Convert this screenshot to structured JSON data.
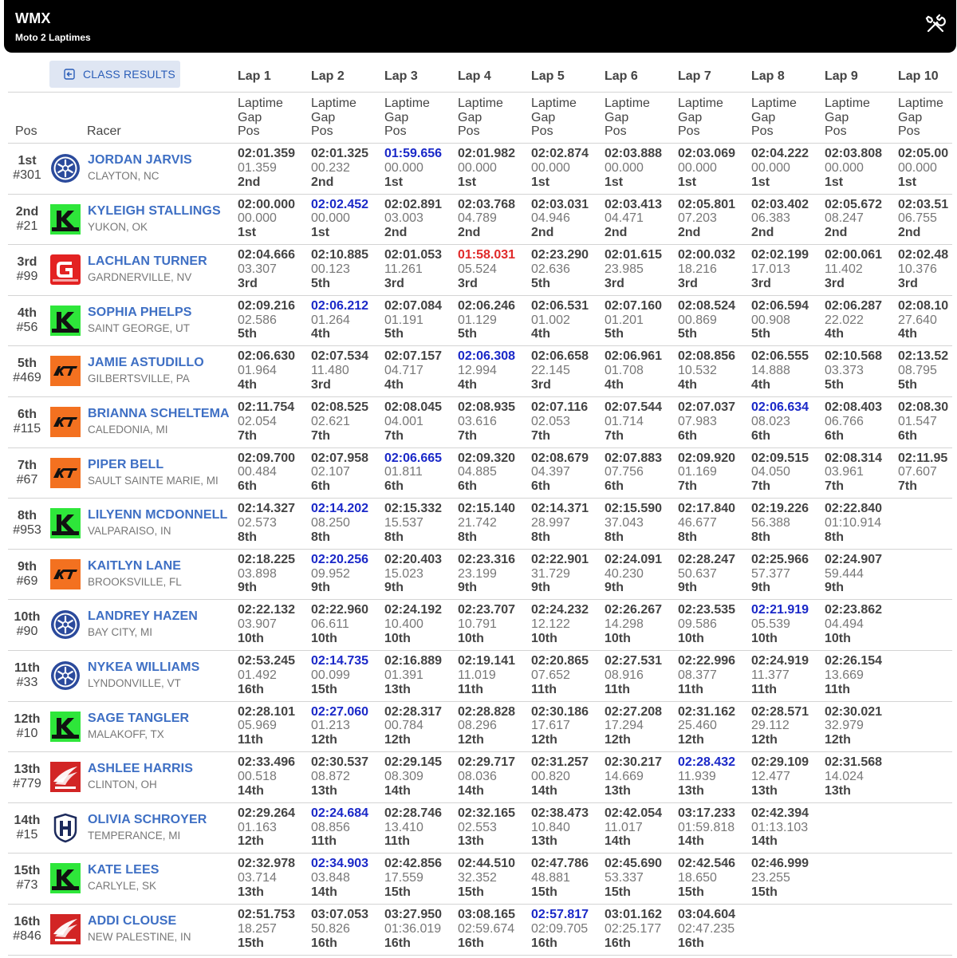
{
  "app": {
    "title": "WMX",
    "subtitle": "Moto 2 Laptimes"
  },
  "class_button": {
    "label": "CLASS RESULTS"
  },
  "headers": {
    "pos": "Pos",
    "racer": "Racer",
    "laps": [
      "Lap 1",
      "Lap 2",
      "Lap 3",
      "Lap 4",
      "Lap 5",
      "Lap 6",
      "Lap 7",
      "Lap 8",
      "Lap 9",
      "Lap 10"
    ],
    "sub": [
      "Laptime",
      "Gap",
      "Pos"
    ]
  },
  "colors": {
    "accent": "#3e6fc4",
    "best_lap": "#1a28c8",
    "worst_lap": "#e02a2a",
    "topbar": "#000000",
    "button_bg": "#dfe6f3"
  },
  "rows": [
    {
      "pos": "1st",
      "num": "#301",
      "name": "JORDAN JARVIS",
      "loc": "CLAYTON, NC",
      "logo": "yamaha-logo",
      "laps": [
        {
          "t": "02:01.359",
          "g": "01.359",
          "p": "2nd"
        },
        {
          "t": "02:01.325",
          "g": "00.232",
          "p": "2nd"
        },
        {
          "t": "01:59.656",
          "g": "00.000",
          "p": "1st",
          "s": "best"
        },
        {
          "t": "02:01.982",
          "g": "00.000",
          "p": "1st"
        },
        {
          "t": "02:02.874",
          "g": "00.000",
          "p": "1st"
        },
        {
          "t": "02:03.888",
          "g": "00.000",
          "p": "1st"
        },
        {
          "t": "02:03.069",
          "g": "00.000",
          "p": "1st"
        },
        {
          "t": "02:04.222",
          "g": "00.000",
          "p": "1st"
        },
        {
          "t": "02:03.808",
          "g": "00.000",
          "p": "1st"
        },
        {
          "t": "02:05.00",
          "g": "00.000",
          "p": "1st"
        }
      ]
    },
    {
      "pos": "2nd",
      "num": "#21",
      "name": "KYLEIGH STALLINGS",
      "loc": "YUKON, OK",
      "logo": "kawasaki-logo",
      "laps": [
        {
          "t": "02:00.000",
          "g": "00.000",
          "p": "1st"
        },
        {
          "t": "02:02.452",
          "g": "00.000",
          "p": "1st",
          "s": "best"
        },
        {
          "t": "02:02.891",
          "g": "03.003",
          "p": "2nd"
        },
        {
          "t": "02:03.768",
          "g": "04.789",
          "p": "2nd"
        },
        {
          "t": "02:03.031",
          "g": "04.946",
          "p": "2nd"
        },
        {
          "t": "02:03.413",
          "g": "04.471",
          "p": "2nd"
        },
        {
          "t": "02:05.801",
          "g": "07.203",
          "p": "2nd"
        },
        {
          "t": "02:03.402",
          "g": "06.383",
          "p": "2nd"
        },
        {
          "t": "02:05.672",
          "g": "08.247",
          "p": "2nd"
        },
        {
          "t": "02:03.51",
          "g": "06.755",
          "p": "2nd"
        }
      ]
    },
    {
      "pos": "3rd",
      "num": "#99",
      "name": "LACHLAN TURNER",
      "loc": "GARDNERVILLE, NV",
      "logo": "gasgas-logo",
      "laps": [
        {
          "t": "02:04.666",
          "g": "03.307",
          "p": "3rd"
        },
        {
          "t": "02:10.885",
          "g": "00.123",
          "p": "5th"
        },
        {
          "t": "02:01.053",
          "g": "11.261",
          "p": "3rd"
        },
        {
          "t": "01:58.031",
          "g": "05.524",
          "p": "3rd",
          "s": "worst"
        },
        {
          "t": "02:23.290",
          "g": "02.636",
          "p": "5th"
        },
        {
          "t": "02:01.615",
          "g": "23.985",
          "p": "3rd"
        },
        {
          "t": "02:00.032",
          "g": "18.216",
          "p": "3rd"
        },
        {
          "t": "02:02.199",
          "g": "17.013",
          "p": "3rd"
        },
        {
          "t": "02:00.061",
          "g": "11.402",
          "p": "3rd"
        },
        {
          "t": "02:02.48",
          "g": "10.376",
          "p": "3rd"
        }
      ]
    },
    {
      "pos": "4th",
      "num": "#56",
      "name": "SOPHIA PHELPS",
      "loc": "SAINT GEORGE, UT",
      "logo": "kawasaki-logo",
      "laps": [
        {
          "t": "02:09.216",
          "g": "02.586",
          "p": "5th"
        },
        {
          "t": "02:06.212",
          "g": "01.264",
          "p": "4th",
          "s": "best"
        },
        {
          "t": "02:07.084",
          "g": "01.191",
          "p": "5th"
        },
        {
          "t": "02:06.246",
          "g": "01.129",
          "p": "5th"
        },
        {
          "t": "02:06.531",
          "g": "01.002",
          "p": "4th"
        },
        {
          "t": "02:07.160",
          "g": "01.201",
          "p": "5th"
        },
        {
          "t": "02:08.524",
          "g": "00.869",
          "p": "5th"
        },
        {
          "t": "02:06.594",
          "g": "00.908",
          "p": "5th"
        },
        {
          "t": "02:06.287",
          "g": "22.022",
          "p": "4th"
        },
        {
          "t": "02:08.10",
          "g": "27.640",
          "p": "4th"
        }
      ]
    },
    {
      "pos": "5th",
      "num": "#469",
      "name": "JAMIE ASTUDILLO",
      "loc": "GILBERTSVILLE, PA",
      "logo": "ktm-logo",
      "laps": [
        {
          "t": "02:06.630",
          "g": "01.964",
          "p": "4th"
        },
        {
          "t": "02:07.534",
          "g": "11.480",
          "p": "3rd"
        },
        {
          "t": "02:07.157",
          "g": "04.717",
          "p": "4th"
        },
        {
          "t": "02:06.308",
          "g": "12.994",
          "p": "4th",
          "s": "best"
        },
        {
          "t": "02:06.658",
          "g": "22.145",
          "p": "3rd"
        },
        {
          "t": "02:06.961",
          "g": "01.708",
          "p": "4th"
        },
        {
          "t": "02:08.856",
          "g": "10.532",
          "p": "4th"
        },
        {
          "t": "02:06.555",
          "g": "14.888",
          "p": "4th"
        },
        {
          "t": "02:10.568",
          "g": "03.373",
          "p": "5th"
        },
        {
          "t": "02:13.52",
          "g": "08.795",
          "p": "5th"
        }
      ]
    },
    {
      "pos": "6th",
      "num": "#115",
      "name": "BRIANNA SCHELTEMA",
      "loc": "CALEDONIA, MI",
      "logo": "ktm-logo",
      "laps": [
        {
          "t": "02:11.754",
          "g": "02.054",
          "p": "7th"
        },
        {
          "t": "02:08.525",
          "g": "02.621",
          "p": "7th"
        },
        {
          "t": "02:08.045",
          "g": "04.001",
          "p": "7th"
        },
        {
          "t": "02:08.935",
          "g": "03.616",
          "p": "7th"
        },
        {
          "t": "02:07.116",
          "g": "02.053",
          "p": "7th"
        },
        {
          "t": "02:07.544",
          "g": "01.714",
          "p": "7th"
        },
        {
          "t": "02:07.037",
          "g": "07.983",
          "p": "6th"
        },
        {
          "t": "02:06.634",
          "g": "08.023",
          "p": "6th",
          "s": "best"
        },
        {
          "t": "02:08.403",
          "g": "06.766",
          "p": "6th"
        },
        {
          "t": "02:08.30",
          "g": "01.547",
          "p": "6th"
        }
      ]
    },
    {
      "pos": "7th",
      "num": "#67",
      "name": "PIPER BELL",
      "loc": "SAULT SAINTE MARIE, MI",
      "logo": "ktm-logo",
      "laps": [
        {
          "t": "02:09.700",
          "g": "00.484",
          "p": "6th"
        },
        {
          "t": "02:07.958",
          "g": "02.107",
          "p": "6th"
        },
        {
          "t": "02:06.665",
          "g": "01.811",
          "p": "6th",
          "s": "best"
        },
        {
          "t": "02:09.320",
          "g": "04.885",
          "p": "6th"
        },
        {
          "t": "02:08.679",
          "g": "04.397",
          "p": "6th"
        },
        {
          "t": "02:07.883",
          "g": "07.756",
          "p": "6th"
        },
        {
          "t": "02:09.920",
          "g": "01.169",
          "p": "7th"
        },
        {
          "t": "02:09.515",
          "g": "04.050",
          "p": "7th"
        },
        {
          "t": "02:08.314",
          "g": "03.961",
          "p": "7th"
        },
        {
          "t": "02:11.95",
          "g": "07.607",
          "p": "7th"
        }
      ]
    },
    {
      "pos": "8th",
      "num": "#953",
      "name": "LILYENN MCDONNELL",
      "loc": "VALPARAISO, IN",
      "logo": "kawasaki-logo",
      "laps": [
        {
          "t": "02:14.327",
          "g": "02.573",
          "p": "8th"
        },
        {
          "t": "02:14.202",
          "g": "08.250",
          "p": "8th",
          "s": "best"
        },
        {
          "t": "02:15.332",
          "g": "15.537",
          "p": "8th"
        },
        {
          "t": "02:15.140",
          "g": "21.742",
          "p": "8th"
        },
        {
          "t": "02:14.371",
          "g": "28.997",
          "p": "8th"
        },
        {
          "t": "02:15.590",
          "g": "37.043",
          "p": "8th"
        },
        {
          "t": "02:17.840",
          "g": "46.677",
          "p": "8th"
        },
        {
          "t": "02:19.226",
          "g": "56.388",
          "p": "8th"
        },
        {
          "t": "02:22.840",
          "g": "01:10.914",
          "p": "8th"
        }
      ]
    },
    {
      "pos": "9th",
      "num": "#69",
      "name": "KAITLYN LANE",
      "loc": "BROOKSVILLE, FL",
      "logo": "ktm-logo",
      "laps": [
        {
          "t": "02:18.225",
          "g": "03.898",
          "p": "9th"
        },
        {
          "t": "02:20.256",
          "g": "09.952",
          "p": "9th",
          "s": "best"
        },
        {
          "t": "02:20.403",
          "g": "15.023",
          "p": "9th"
        },
        {
          "t": "02:23.316",
          "g": "23.199",
          "p": "9th"
        },
        {
          "t": "02:22.901",
          "g": "31.729",
          "p": "9th"
        },
        {
          "t": "02:24.091",
          "g": "40.230",
          "p": "9th"
        },
        {
          "t": "02:28.247",
          "g": "50.637",
          "p": "9th"
        },
        {
          "t": "02:25.966",
          "g": "57.377",
          "p": "9th"
        },
        {
          "t": "02:24.907",
          "g": "59.444",
          "p": "9th"
        }
      ]
    },
    {
      "pos": "10th",
      "num": "#90",
      "name": "LANDREY HAZEN",
      "loc": "BAY CITY, MI",
      "logo": "yamaha-logo",
      "laps": [
        {
          "t": "02:22.132",
          "g": "03.907",
          "p": "10th"
        },
        {
          "t": "02:22.960",
          "g": "06.611",
          "p": "10th"
        },
        {
          "t": "02:24.192",
          "g": "10.400",
          "p": "10th"
        },
        {
          "t": "02:23.707",
          "g": "10.791",
          "p": "10th"
        },
        {
          "t": "02:24.232",
          "g": "12.122",
          "p": "10th"
        },
        {
          "t": "02:26.267",
          "g": "14.298",
          "p": "10th"
        },
        {
          "t": "02:23.535",
          "g": "09.586",
          "p": "10th"
        },
        {
          "t": "02:21.919",
          "g": "05.539",
          "p": "10th",
          "s": "best"
        },
        {
          "t": "02:23.862",
          "g": "04.494",
          "p": "10th"
        }
      ]
    },
    {
      "pos": "11th",
      "num": "#33",
      "name": "NYKEA WILLIAMS",
      "loc": "LYNDONVILLE, VT",
      "logo": "yamaha-logo",
      "laps": [
        {
          "t": "02:53.245",
          "g": "01.492",
          "p": "16th"
        },
        {
          "t": "02:14.735",
          "g": "00.099",
          "p": "15th",
          "s": "best"
        },
        {
          "t": "02:16.889",
          "g": "01.391",
          "p": "13th"
        },
        {
          "t": "02:19.141",
          "g": "11.019",
          "p": "11th"
        },
        {
          "t": "02:20.865",
          "g": "07.652",
          "p": "11th"
        },
        {
          "t": "02:27.531",
          "g": "08.916",
          "p": "11th"
        },
        {
          "t": "02:22.996",
          "g": "08.377",
          "p": "11th"
        },
        {
          "t": "02:24.919",
          "g": "11.377",
          "p": "11th"
        },
        {
          "t": "02:26.154",
          "g": "13.669",
          "p": "11th"
        }
      ]
    },
    {
      "pos": "12th",
      "num": "#10",
      "name": "SAGE TANGLER",
      "loc": "MALAKOFF, TX",
      "logo": "kawasaki-logo",
      "laps": [
        {
          "t": "02:28.101",
          "g": "05.969",
          "p": "11th"
        },
        {
          "t": "02:27.060",
          "g": "01.213",
          "p": "12th",
          "s": "best"
        },
        {
          "t": "02:28.317",
          "g": "00.784",
          "p": "12th"
        },
        {
          "t": "02:28.828",
          "g": "08.296",
          "p": "12th"
        },
        {
          "t": "02:30.186",
          "g": "17.617",
          "p": "12th"
        },
        {
          "t": "02:27.208",
          "g": "17.294",
          "p": "12th"
        },
        {
          "t": "02:31.162",
          "g": "25.460",
          "p": "12th"
        },
        {
          "t": "02:28.571",
          "g": "29.112",
          "p": "12th"
        },
        {
          "t": "02:30.021",
          "g": "32.979",
          "p": "12th"
        }
      ]
    },
    {
      "pos": "13th",
      "num": "#779",
      "name": "ASHLEE HARRIS",
      "loc": "CLINTON, OH",
      "logo": "honda-logo",
      "laps": [
        {
          "t": "02:33.496",
          "g": "00.518",
          "p": "14th"
        },
        {
          "t": "02:30.537",
          "g": "08.872",
          "p": "13th"
        },
        {
          "t": "02:29.145",
          "g": "08.309",
          "p": "14th"
        },
        {
          "t": "02:29.717",
          "g": "08.036",
          "p": "14th"
        },
        {
          "t": "02:31.257",
          "g": "00.820",
          "p": "14th"
        },
        {
          "t": "02:30.217",
          "g": "14.669",
          "p": "13th"
        },
        {
          "t": "02:28.432",
          "g": "11.939",
          "p": "13th",
          "s": "best"
        },
        {
          "t": "02:29.109",
          "g": "12.477",
          "p": "13th"
        },
        {
          "t": "02:31.568",
          "g": "14.024",
          "p": "13th"
        }
      ]
    },
    {
      "pos": "14th",
      "num": "#15",
      "name": "OLIVIA SCHROYER",
      "loc": "TEMPERANCE, MI",
      "logo": "husqvarna-logo",
      "laps": [
        {
          "t": "02:29.264",
          "g": "01.163",
          "p": "12th"
        },
        {
          "t": "02:24.684",
          "g": "08.856",
          "p": "11th",
          "s": "best"
        },
        {
          "t": "02:28.746",
          "g": "13.410",
          "p": "11th"
        },
        {
          "t": "02:32.165",
          "g": "02.553",
          "p": "13th"
        },
        {
          "t": "02:38.473",
          "g": "10.840",
          "p": "13th"
        },
        {
          "t": "02:42.054",
          "g": "11.017",
          "p": "14th"
        },
        {
          "t": "03:17.233",
          "g": "01:59.818",
          "p": "14th"
        },
        {
          "t": "02:42.394",
          "g": "01:13.103",
          "p": "14th"
        }
      ]
    },
    {
      "pos": "15th",
      "num": "#73",
      "name": "KATE LEES",
      "loc": "CARLYLE, SK",
      "logo": "kawasaki-logo",
      "laps": [
        {
          "t": "02:32.978",
          "g": "03.714",
          "p": "13th"
        },
        {
          "t": "02:34.903",
          "g": "03.848",
          "p": "14th",
          "s": "best"
        },
        {
          "t": "02:42.856",
          "g": "17.559",
          "p": "15th"
        },
        {
          "t": "02:44.510",
          "g": "32.352",
          "p": "15th"
        },
        {
          "t": "02:47.786",
          "g": "48.881",
          "p": "15th"
        },
        {
          "t": "02:45.690",
          "g": "53.337",
          "p": "15th"
        },
        {
          "t": "02:42.546",
          "g": "18.650",
          "p": "15th"
        },
        {
          "t": "02:46.999",
          "g": "23.255",
          "p": "15th"
        }
      ]
    },
    {
      "pos": "16th",
      "num": "#846",
      "name": "ADDI CLOUSE",
      "loc": "NEW PALESTINE, IN",
      "logo": "honda-logo",
      "laps": [
        {
          "t": "02:51.753",
          "g": "18.257",
          "p": "15th"
        },
        {
          "t": "03:07.053",
          "g": "50.826",
          "p": "16th"
        },
        {
          "t": "03:27.950",
          "g": "01:36.019",
          "p": "16th"
        },
        {
          "t": "03:08.165",
          "g": "02:59.674",
          "p": "16th"
        },
        {
          "t": "02:57.817",
          "g": "02:09.705",
          "p": "16th",
          "s": "best"
        },
        {
          "t": "03:01.162",
          "g": "02:25.177",
          "p": "16th"
        },
        {
          "t": "03:04.604",
          "g": "02:47.235",
          "p": "16th"
        }
      ]
    }
  ]
}
